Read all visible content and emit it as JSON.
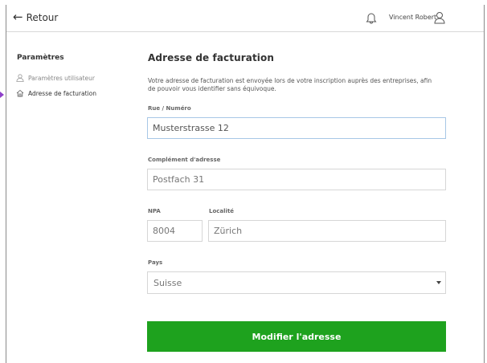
{
  "header": {
    "back_label": "Retour",
    "user_name": "Vincent Robert"
  },
  "sidebar": {
    "title": "Paramètres",
    "items": [
      {
        "label": "Paramètres utilisateur",
        "icon": "user-icon",
        "active": false
      },
      {
        "label": "Adresse de facturation",
        "icon": "home-icon",
        "active": true
      }
    ]
  },
  "form": {
    "title": "Adresse de facturation",
    "description": "Votre adresse de facturation est envoyée lors de votre inscription auprès des entreprises, afin de pouvoir vous identifier sans équivoque.",
    "street": {
      "label": "Rue / Numéro",
      "value": "Musterstrasse 12"
    },
    "complement": {
      "label": "Complément d'adresse",
      "value": "Postfach 31"
    },
    "npa": {
      "label": "NPA",
      "value": "8004"
    },
    "locality": {
      "label": "Localité",
      "value": "Zürich"
    },
    "country": {
      "label": "Pays",
      "value": "Suisse"
    },
    "submit_label": "Modifier l'adresse"
  },
  "colors": {
    "submit_background": "#1ea21e",
    "focus_border": "#a7c7e6",
    "active_marker": "#8e3fc9"
  }
}
